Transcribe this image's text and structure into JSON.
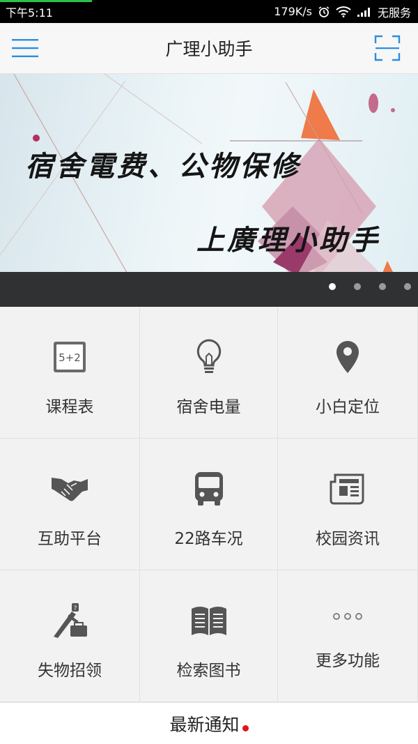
{
  "status_bar": {
    "time": "下午5:11",
    "network_speed": "179K/s",
    "carrier": "无服务",
    "icons": [
      "alarm-icon",
      "wifi-icon",
      "signal-icon"
    ]
  },
  "app_bar": {
    "title": "广理小助手",
    "menu_icon": "menu-icon",
    "scan_icon": "scan-icon",
    "accent_color": "#2a8ee0"
  },
  "banner": {
    "line1": "宿舍電费、公物保修",
    "line2": "上廣理小助手",
    "slide_count": 4,
    "active_slide": 1
  },
  "grid": {
    "items": [
      {
        "label": "课程表",
        "icon": "calculator-board-icon"
      },
      {
        "label": "宿舍电量",
        "icon": "lightbulb-icon"
      },
      {
        "label": "小白定位",
        "icon": "location-pin-icon"
      },
      {
        "label": "互助平台",
        "icon": "handshake-icon"
      },
      {
        "label": "22路车况",
        "icon": "bus-icon"
      },
      {
        "label": "校园资讯",
        "icon": "newspaper-icon"
      },
      {
        "label": "失物招领",
        "icon": "umbrella-bag-icon"
      },
      {
        "label": "检索图书",
        "icon": "open-book-icon"
      },
      {
        "label": "更多功能",
        "icon": "more-dots-icon"
      }
    ]
  },
  "notice": {
    "label": "最新通知",
    "unread_dot_color": "#e0141e"
  }
}
